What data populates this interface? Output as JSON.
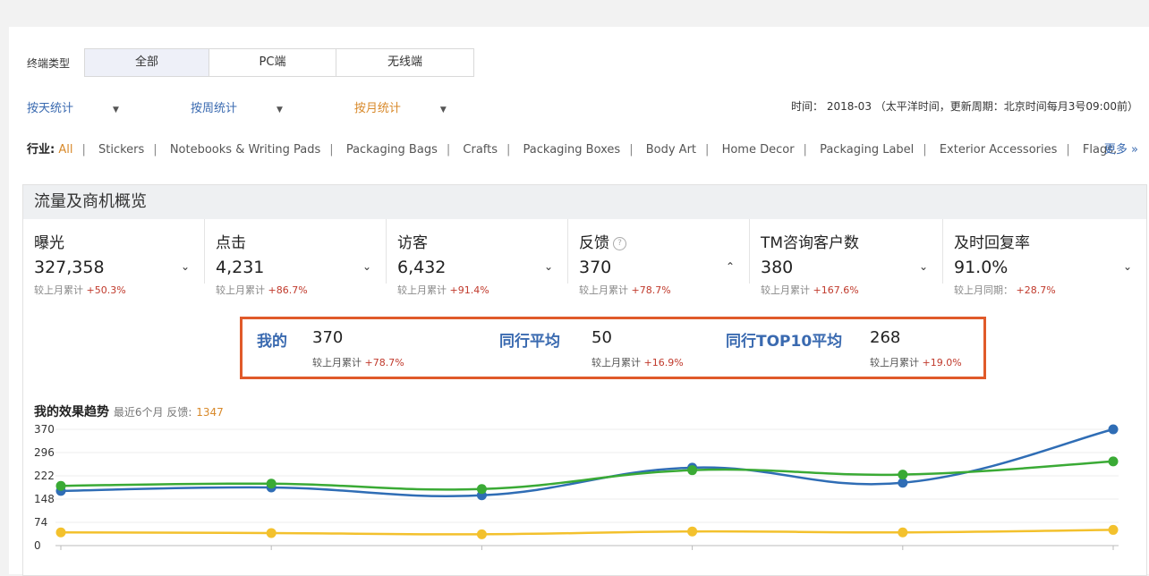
{
  "filters": {
    "terminal_label": "终端类型",
    "terminal_options": [
      "全部",
      "PC端",
      "无线端"
    ],
    "stat_links": [
      "按天统计",
      "按周统计",
      "按月统计"
    ],
    "time_info": "时间： 2018-03 （太平洋时间，更新周期：北京时间每月3号09:00前）"
  },
  "industry": {
    "label": "行业:",
    "items": [
      "All",
      "Stickers",
      "Notebooks & Writing Pads",
      "Packaging Bags",
      "Crafts",
      "Packaging Boxes",
      "Body Art",
      "Home Decor",
      "Packaging Label",
      "Exterior Accessories",
      "Flags,"
    ],
    "more": "更多"
  },
  "panel": {
    "title": "流量及商机概览",
    "kpis": [
      {
        "title": "曝光",
        "value": "327,358",
        "compare_label": "较上月累计",
        "change": "+50.3%",
        "chevron": "⌄"
      },
      {
        "title": "点击",
        "value": "4,231",
        "compare_label": "较上月累计",
        "change": "+86.7%",
        "chevron": "⌄"
      },
      {
        "title": "访客",
        "value": "6,432",
        "compare_label": "较上月累计",
        "change": "+91.4%",
        "chevron": "⌄"
      },
      {
        "title": "反馈",
        "value": "370",
        "compare_label": "较上月累计",
        "change": "+78.7%",
        "chevron": "⌃"
      },
      {
        "title": "TM咨询客户数",
        "value": "380",
        "compare_label": "较上月累计",
        "change": "+167.6%",
        "chevron": "⌄"
      },
      {
        "title": "及时回复率",
        "value": "91.0%",
        "compare_label": "较上月同期：",
        "change": "+28.7%",
        "chevron": "⌄"
      }
    ]
  },
  "compare": {
    "mine": {
      "label": "我的",
      "value": "370",
      "compare_label": "较上月累计",
      "change": "+78.7%"
    },
    "peer_avg": {
      "label": "同行平均",
      "value": "50",
      "compare_label": "较上月累计",
      "change": "+16.9%"
    },
    "peer_top10": {
      "label": "同行TOP10平均",
      "value": "268",
      "compare_label": "较上月累计",
      "change": "+19.0%"
    }
  },
  "trend": {
    "title": "我的效果趋势",
    "subtitle": "最近6个月 反馈:",
    "total": "1347"
  },
  "colors": {
    "mine": "#2f6db5",
    "top10": "#3aaa35",
    "avg": "#f3c12d",
    "accent": "#e05a2a"
  },
  "chart_data": {
    "type": "line",
    "y_ticks": [
      370,
      296,
      222,
      148,
      74,
      0
    ],
    "ylim": [
      0,
      370
    ],
    "x_count": 6,
    "series": [
      {
        "values": [
          174,
          185,
          160,
          248,
          200,
          370
        ]
      },
      {
        "values": [
          190,
          197,
          180,
          240,
          226,
          268
        ]
      },
      {
        "values": [
          42,
          40,
          36,
          45,
          42,
          50
        ]
      }
    ]
  }
}
